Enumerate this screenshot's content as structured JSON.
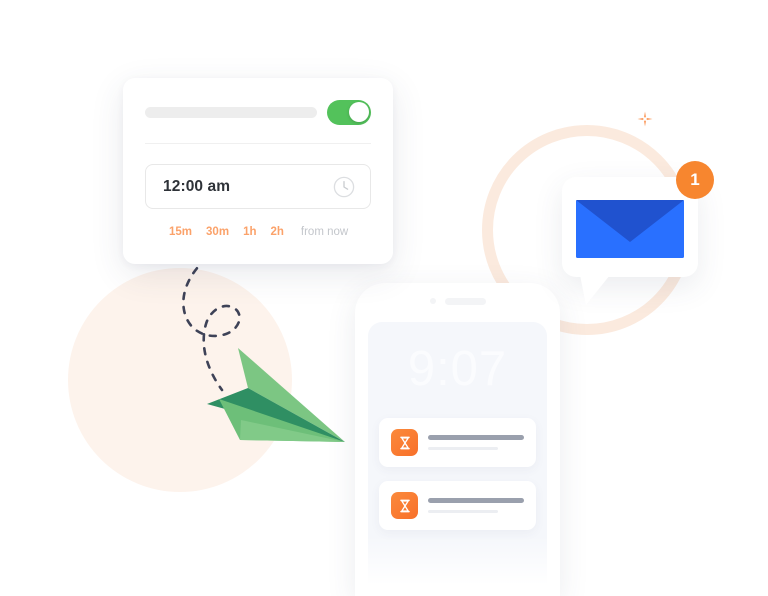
{
  "scheduler_card": {
    "toggle": {
      "name": "schedule-toggle",
      "state": "on",
      "color": "#53c25b"
    },
    "title_placeholder": "",
    "time_field": {
      "value": "12:00 am",
      "icon": "clock-icon"
    },
    "quick_options": [
      {
        "label": "15m"
      },
      {
        "label": "30m"
      },
      {
        "label": "1h"
      },
      {
        "label": "2h"
      }
    ],
    "quick_suffix": "from now",
    "quick_color": "#fba26a"
  },
  "phone": {
    "clock": "9:07",
    "notifications": [
      {
        "icon": "hourglass-icon",
        "line_1": "",
        "line_2": ""
      },
      {
        "icon": "hourglass-icon",
        "line_1": "",
        "line_2": ""
      }
    ],
    "screen_color": "#f5f7fb",
    "icon_color": "#f8702a"
  },
  "mail_bubble": {
    "icon": "envelope-icon",
    "badge_count": "1",
    "badge_color": "#f7862f",
    "envelope_color": "#2970ff",
    "envelope_flap_color": "#2052cf"
  },
  "decorations": {
    "peach_blob": "#fdf3ec",
    "peach_ring": "#fbeade",
    "sparkle": "sparkle-icon",
    "sparkle_color": "#fba26a",
    "flight_path": "dashed-path",
    "flight_path_color": "#3e4257",
    "paper_plane": "paper-plane-icon",
    "paper_plane_light": "#79c47e",
    "paper_plane_dark": "#2f8f63"
  }
}
